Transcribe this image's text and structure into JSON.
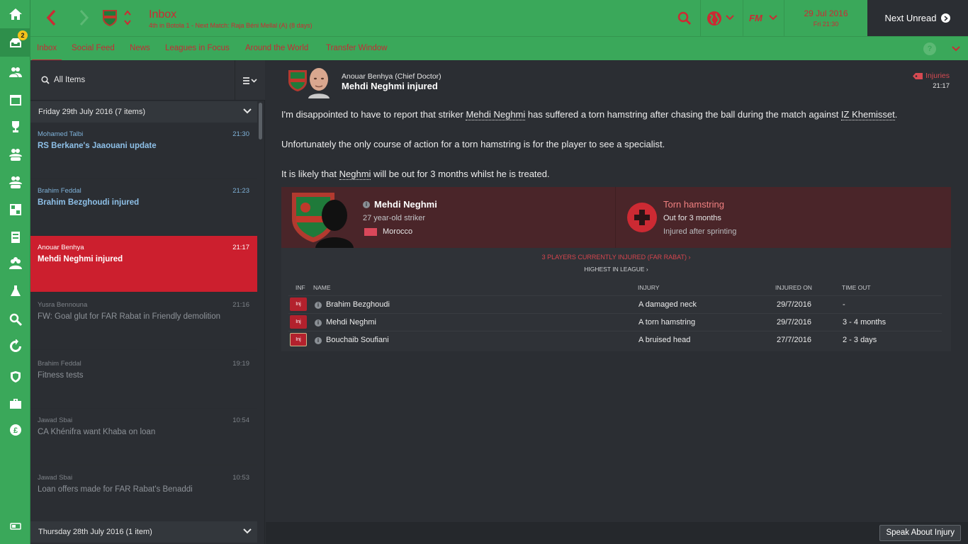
{
  "sidebar": {
    "inbox_badge": "2",
    "items": [
      "home-icon",
      "inbox-icon",
      "squad-icon",
      "calendar-icon",
      "trophy-icon",
      "u21-icon",
      "u18-icon",
      "tactics-icon",
      "training-icon",
      "staff-icon",
      "scouting-icon",
      "search-icon",
      "transfers-icon",
      "club-vision-icon",
      "club-info-icon",
      "finances-icon",
      "notes-icon"
    ]
  },
  "header": {
    "title": "Inbox",
    "subtitle": "4th in Botola 1 - Next Match: Raja Béni Mellal (A) (8 days)",
    "date": "29 Jul 2016",
    "day_time": "Fri 21:30",
    "next_unread": "Next Unread"
  },
  "tabs": [
    {
      "label": "Inbox"
    },
    {
      "label": "Social Feed"
    },
    {
      "label": "News"
    },
    {
      "label": "Leagues in Focus"
    },
    {
      "label": "Around the World"
    },
    {
      "label": "Transfer Window"
    }
  ],
  "list": {
    "filter_label": "All Items",
    "group1": "Friday 29th July 2016 (7 items)",
    "group2": "Thursday 28th July 2016 (1 item)",
    "messages": [
      {
        "from": "Mohamed Talbi",
        "time": "21:30",
        "subject": "RS Berkane's Jaaouani update"
      },
      {
        "from": "Brahim Feddal",
        "time": "21:23",
        "subject": "Brahim Bezghoudi injured"
      },
      {
        "from": "Anouar Benhya",
        "time": "21:17",
        "subject": "Mehdi Neghmi injured"
      },
      {
        "from": "Yusra Bennouna",
        "time": "21:16",
        "subject": "FW: Goal glut for FAR Rabat in Friendly demolition"
      },
      {
        "from": "Brahim Feddal",
        "time": "19:19",
        "subject": "Fitness tests"
      },
      {
        "from": "Jawad Sbai",
        "time": "10:54",
        "subject": "CA Khénifra want Khaba on loan"
      },
      {
        "from": "Jawad Sbai",
        "time": "10:53",
        "subject": "Loan offers made for FAR Rabat's Benaddi"
      }
    ]
  },
  "message": {
    "sender": "Anouar Benhya  (Chief Doctor)",
    "title": "Mehdi Neghmi injured",
    "category": "Injuries",
    "time": "21:17",
    "p1_a": "I'm disappointed to have to report that striker ",
    "p1_player": "Mehdi Neghmi",
    "p1_b": " has suffered a torn hamstring after chasing the ball during the match against ",
    "p1_team": "IZ Khemisset",
    "p1_c": ".",
    "p2": "Unfortunately the only course of action for a torn hamstring is for the player to see a specialist.",
    "p3_a": "It is likely that ",
    "p3_player": "Neghmi",
    "p3_b": " will be out for 3 months whilst he is treated."
  },
  "injury": {
    "player_name": "Mehdi Neghmi",
    "player_desc": "27 year-old striker",
    "nationality": "Morocco",
    "injury_name": "Torn hamstring",
    "out_for": "Out for 3 months",
    "cause": "Injured after sprinting",
    "currently_injured": "3 PLAYERS CURRENTLY INJURED (FAR RABAT)",
    "highest": "HIGHEST IN LEAGUE",
    "columns": {
      "inf": "INF",
      "name": "NAME",
      "injury": "INJURY",
      "injured_on": "INJURED ON",
      "time_out": "TIME OUT"
    },
    "rows": [
      {
        "tag": "Inj",
        "name": "Brahim Bezghoudi",
        "injury": "A damaged neck",
        "injured_on": "29/7/2016",
        "time_out": "-"
      },
      {
        "tag": "Inj",
        "name": "Mehdi Neghmi",
        "injury": "A torn hamstring",
        "injured_on": "29/7/2016",
        "time_out": "3 - 4 months"
      },
      {
        "tag": "Inj",
        "name": "Bouchaib Soufiani",
        "injury": "A bruised head",
        "injured_on": "27/7/2016",
        "time_out": "2 - 3 days"
      }
    ]
  },
  "footer": {
    "speak_button": "Speak About Injury"
  },
  "colors": {
    "accent_green": "#3aa85a",
    "accent_red": "#cc1f2e",
    "panel_dark": "#2b2e33"
  }
}
